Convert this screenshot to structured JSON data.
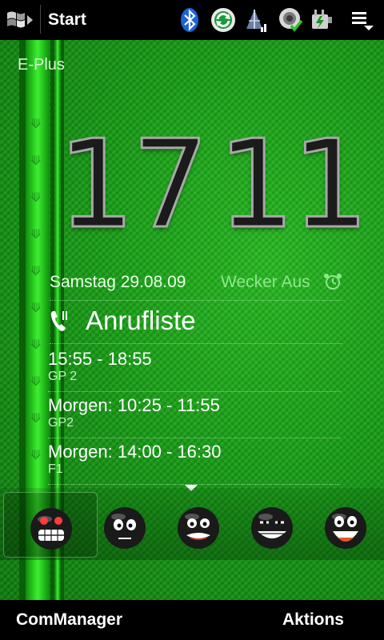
{
  "statusbar": {
    "title": "Start",
    "icons": [
      "windows-start-icon",
      "bluetooth-icon",
      "sync-icon",
      "signal-icon",
      "volume-icon",
      "battery-charging-icon",
      "menu-icon"
    ]
  },
  "home": {
    "operator": "E-Plus",
    "clock": {
      "hours": "17",
      "minutes": "11"
    },
    "date": "Samstag 29.08.09",
    "alarm": "Wecker Aus",
    "calls_title": "Anrufliste",
    "events": [
      {
        "time": "15:55 - 18:55",
        "sub": "GP 2"
      },
      {
        "time": "Morgen: 10:25 - 11:55",
        "sub": "GP2"
      },
      {
        "time": "Morgen: 14:00 - 16:30",
        "sub": "F1"
      }
    ]
  },
  "launcher": {
    "items": [
      "angry-face-icon",
      "worried-face-icon",
      "grimace-face-icon",
      "grin-face-icon",
      "laughing-face-icon"
    ],
    "selected_index": 0
  },
  "softkeys": {
    "left": "ComManager",
    "right": "Aktions"
  },
  "colors": {
    "accent_green": "#169c14",
    "bright_stripe": "#3cf02f",
    "bar_black": "#000000"
  }
}
